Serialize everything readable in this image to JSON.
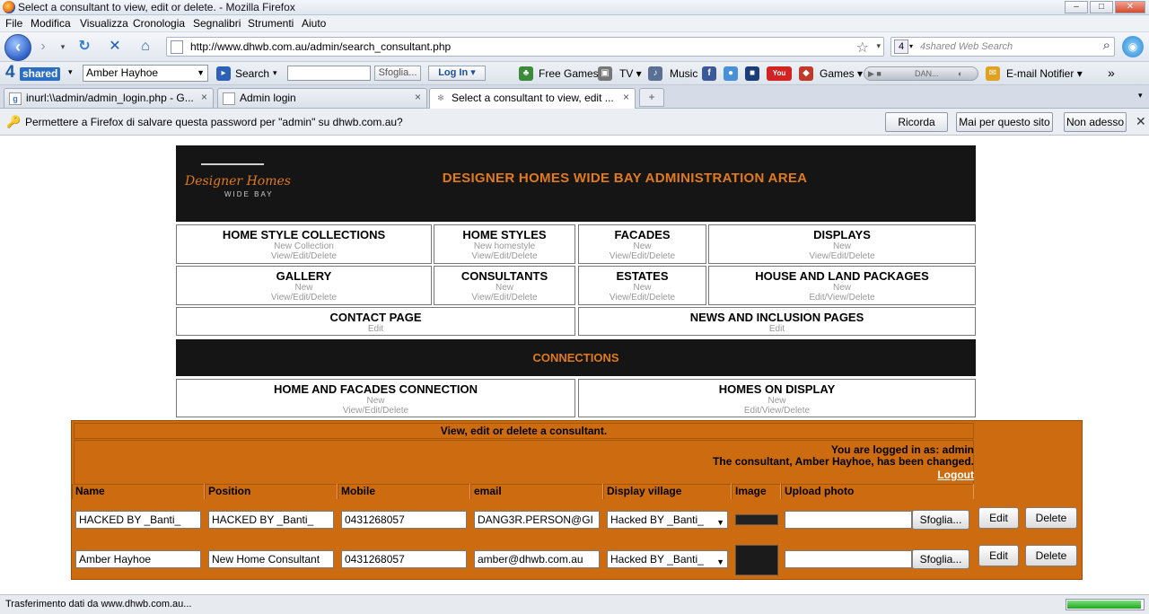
{
  "window": {
    "title": "Select a consultant to view, edit or delete. - Mozilla Firefox",
    "controls": [
      "–",
      "□",
      "✕"
    ]
  },
  "menu": [
    "File",
    "Modifica",
    "Visualizza",
    "Cronologia",
    "Segnalibri",
    "Strumenti",
    "Aiuto"
  ],
  "nav": {
    "url": "http://www.dhwb.com.au/admin/search_consultant.php",
    "search_placeholder": "4shared Web Search"
  },
  "toolbar": {
    "logo_num": "4",
    "logo_text": "shared",
    "account": "Amber Hayhoe",
    "search_label": "Search",
    "browse_label": "Sfoglia...",
    "login_label": "Log In",
    "free_games": "Free Games",
    "tv": "TV",
    "music": "Music",
    "games": "Games",
    "radio": "DAN...",
    "email_notifier": "E-mail Notifier",
    "more": "»"
  },
  "tabs": [
    {
      "label": "inurl:\\\\admin/admin_login.php - G..."
    },
    {
      "label": "Admin login"
    },
    {
      "label": "Select a consultant to view, edit ..."
    }
  ],
  "notification": {
    "message": "Permettere a Firefox di salvare questa password per \"admin\" su dhwb.com.au?",
    "remember": "Ricorda",
    "never": "Mai per questo sito",
    "not_now": "Non adesso"
  },
  "site": {
    "logo_line1": "Designer Homes",
    "logo_line2": "WIDE BAY",
    "header_title": "DESIGNER HOMES WIDE BAY ADMINISTRATION AREA",
    "nav_cells": [
      {
        "title": "HOME STYLE COLLECTIONS",
        "sub1": "New Collection",
        "sub2": "View/Edit/Delete"
      },
      {
        "title": "HOME STYLES",
        "sub1": "New homestyle",
        "sub2": "View/Edit/Delete"
      },
      {
        "title": "FACADES",
        "sub1": "New",
        "sub2": "View/Edit/Delete"
      },
      {
        "title": "DISPLAYS",
        "sub1": "New",
        "sub2": "View/Edit/Delete"
      },
      {
        "title": "GALLERY",
        "sub1": "New",
        "sub2": "View/Edit/Delete"
      },
      {
        "title": "CONSULTANTS",
        "sub1": "New",
        "sub2": "View/Edit/Delete"
      },
      {
        "title": "ESTATES",
        "sub1": "New",
        "sub2": "View/Edit/Delete"
      },
      {
        "title": "HOUSE AND LAND PACKAGES",
        "sub1": "New",
        "sub2": "Edit/View/Delete"
      },
      {
        "title": "CONTACT PAGE",
        "sub1": "Edit"
      },
      {
        "title": "NEWS AND INCLUSION PAGES",
        "sub1": "Edit"
      }
    ],
    "connections_title": "CONNECTIONS",
    "conn_cells": [
      {
        "title": "HOME AND FACADES CONNECTION",
        "sub1": "New",
        "sub2": "View/Edit/Delete"
      },
      {
        "title": "HOMES ON DISPLAY",
        "sub1": "New",
        "sub2": "Edit/View/Delete"
      }
    ],
    "panel_title": "View, edit or delete a consultant.",
    "logged_in": "You are logged in as: admin",
    "changed_msg": "The consultant, Amber Hayhoe, has been changed.",
    "logout": "Logout",
    "table_headers": [
      "Name",
      "Position",
      "Mobile",
      "email",
      "Display village",
      "Image",
      "Upload photo"
    ],
    "rows": [
      {
        "name": "HACKED BY _Banti_",
        "position": "HACKED BY _Banti_",
        "mobile": "0431268057",
        "email": "DANG3R.PERSON@GI",
        "village": "Hacked BY _Banti_",
        "browse": "Sfoglia...",
        "edit": "Edit",
        "delete": "Delete"
      },
      {
        "name": "Amber Hayhoe",
        "position": "New Home Consultant",
        "mobile": "0431268057",
        "email": "amber@dhwb.com.au",
        "village": "Hacked BY _Banti_",
        "browse": "Sfoglia...",
        "edit": "Edit",
        "delete": "Delete"
      }
    ]
  },
  "status": {
    "text": "Trasferimento dati da www.dhwb.com.au...",
    "progress": 0.95
  },
  "colors": {
    "accent_orange": "#e07a1b",
    "panel_orange": "#cc6b0f",
    "header_dark": "#151515"
  }
}
